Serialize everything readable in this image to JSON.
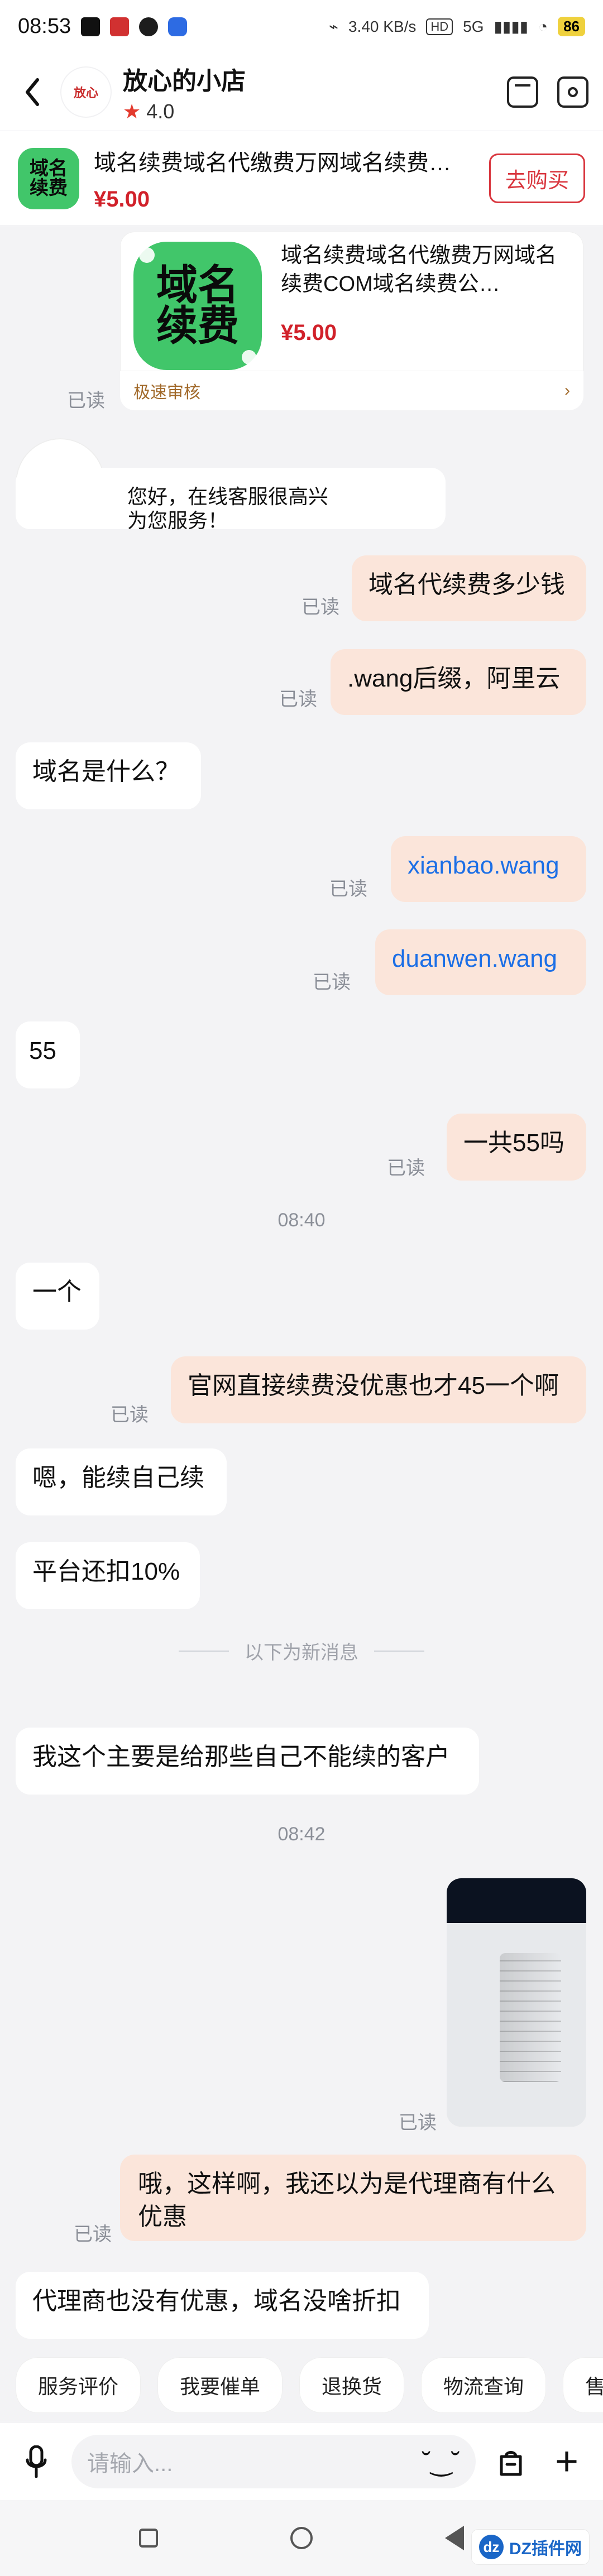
{
  "status": {
    "time": "08:53",
    "speed": "3.40 KB/s",
    "network": "5G",
    "battery": "86"
  },
  "header": {
    "shop_name": "放心的小店",
    "rating": "4.0"
  },
  "product_bar": {
    "title": "域名续费域名代缴费万网域名续费…",
    "price": "¥5.00",
    "buy_label": "去购买",
    "thumb_text_top": "域名",
    "thumb_text_bottom": "续费"
  },
  "product_card": {
    "title": "域名续费域名代缴费万网域名续费COM域名续费公…",
    "price": "¥5.00",
    "footer_left": "极速审核",
    "footer_right": "›",
    "thumb_text_top": "域名",
    "thumb_text_bottom": "续费"
  },
  "chat": {
    "read_label": "已读",
    "messages": [
      {
        "text": "您好，在线客服很高兴为您服务！"
      },
      {
        "text": "域名代续费多少钱"
      },
      {
        "text": ".wang后缀，阿里云"
      },
      {
        "text": "域名是什么？"
      },
      {
        "text": "xianbao.wang"
      },
      {
        "text": "duanwen.wang"
      },
      {
        "text": "55"
      },
      {
        "text": "一共55吗"
      },
      {
        "time": "08:40"
      },
      {
        "text": "一个"
      },
      {
        "text": "官网直接续费没优惠也才45一个啊"
      },
      {
        "text": "嗯，能续自己续"
      },
      {
        "text": "平台还扣10%"
      },
      {
        "divider": "以下为新消息"
      },
      {
        "text": "我这个主要是给那些自己不能续的客户"
      },
      {
        "time": "08:42"
      },
      {
        "text": "哦，这样啊，我还以为是代理商有什么优惠"
      },
      {
        "text": "代理商也没有优惠，域名没啥折扣"
      }
    ]
  },
  "quick_actions": [
    "服务评价",
    "我要催单",
    "退换货",
    "物流查询",
    "售后"
  ],
  "composer": {
    "placeholder": "请输入..."
  },
  "watermark": {
    "text": "DZ插件网"
  },
  "icons": {
    "back": "chevron-left-icon",
    "store": "store-icon",
    "settings": "gear-icon",
    "star": "star-icon",
    "mic": "mic-icon",
    "smile": "smile-icon",
    "bag": "bag-icon",
    "plus": "plus-icon",
    "nav_recent": "square-icon",
    "nav_home": "circle-icon",
    "nav_back": "triangle-back-icon"
  }
}
